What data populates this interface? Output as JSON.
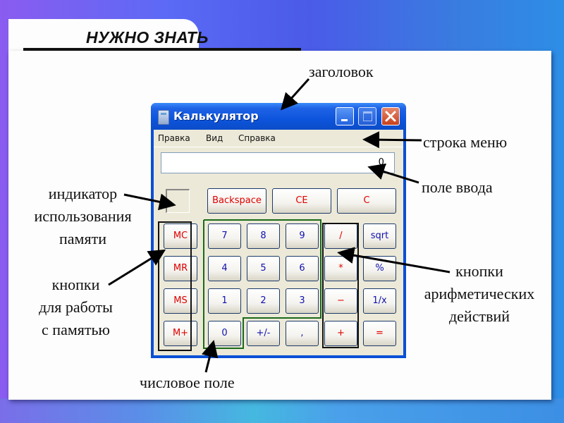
{
  "slide": {
    "heading": "НУЖНО ЗНАТЬ",
    "annotations": {
      "title_bar": "заголовок",
      "menu_bar": "строка меню",
      "input_field": "поле ввода",
      "memory_indicator": [
        "индикатор",
        "использования",
        "памяти"
      ],
      "memory_buttons": [
        "кнопки",
        "для работы",
        "с памятью"
      ],
      "arithmetic_buttons": [
        "кнопки",
        "арифметических",
        "действий"
      ],
      "number_field": "числовое поле"
    }
  },
  "window": {
    "title": "Калькулятор",
    "icon": "calculator-icon",
    "controls": [
      "minimize",
      "maximize",
      "close"
    ],
    "menu": [
      "Правка",
      "Вид",
      "Справка"
    ],
    "display_value": "0,"
  },
  "buttons": {
    "top_row": [
      "Backspace",
      "CE",
      "C"
    ],
    "memory": [
      "MC",
      "MR",
      "MS",
      "M+"
    ],
    "rows": [
      [
        "7",
        "8",
        "9",
        "/",
        "sqrt"
      ],
      [
        "4",
        "5",
        "6",
        "*",
        "%"
      ],
      [
        "1",
        "2",
        "3",
        "−",
        "1/x"
      ],
      [
        "0",
        "+/-",
        ",",
        "+",
        "="
      ]
    ]
  },
  "colors": {
    "function_text": "#e00000",
    "digit_text": "#1010b0",
    "digit_group_outline": "#1a6a1a",
    "titlebar": "#0d55dd"
  }
}
